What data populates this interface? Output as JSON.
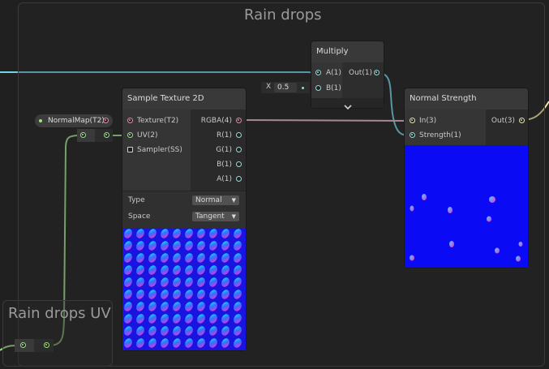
{
  "groups": {
    "main_title": "Rain drops",
    "uv_title": "Rain drops UV"
  },
  "multiply": {
    "title": "Multiply",
    "input_a": "A(1)",
    "input_b": "B(1)",
    "output": "Out(1)",
    "x_label": "X",
    "x_value": "0.5",
    "expand_icon": "chevron-down-icon"
  },
  "sample_texture": {
    "title": "Sample Texture 2D",
    "inputs": [
      "Texture(T2)",
      "UV(2)",
      "Sampler(SS)"
    ],
    "outputs": [
      "RGBA(4)",
      "R(1)",
      "G(1)",
      "B(1)",
      "A(1)"
    ],
    "type_label": "Type",
    "type_value": "Normal",
    "space_label": "Space",
    "space_value": "Tangent"
  },
  "normal_strength": {
    "title": "Normal Strength",
    "inputs": [
      "In(3)",
      "Strength(1)"
    ],
    "output": "Out(3)"
  },
  "property": {
    "label": "NormalMap(T2)"
  },
  "colors": {
    "wire_float": "#7fd6e0",
    "wire_vector2": "#9fe08a",
    "wire_vector4": "#f2b8d0",
    "preview_blue": "#0a0af5"
  }
}
